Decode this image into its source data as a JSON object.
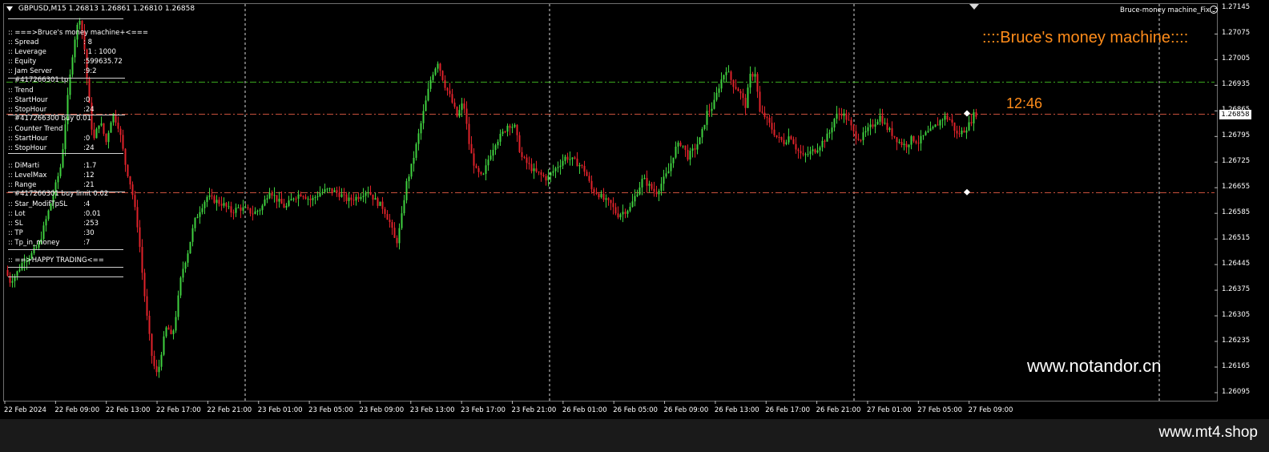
{
  "header": {
    "symbol": "GBPUSD,M15",
    "ohlc": "1.26813 1.26861 1.26810 1.26858",
    "ea_name": "Bruce-money machine_Fix"
  },
  "overlay": {
    "title": "::::Bruce's money machine::::",
    "timer": "12:46",
    "watermark": "www.notandor.cn",
    "site": "www.mt4.shop"
  },
  "info_panel": {
    "lines": [
      {
        "k": ":: ===>Bruce's money machine+<===",
        "v": ""
      },
      {
        "k": ":: Spread",
        "v": ": 8"
      },
      {
        "k": ":: Leverage",
        "v": ": 1 : 1000"
      },
      {
        "k": ":: Equity",
        "v": ":599635.72"
      },
      {
        "k": ":: Jam Server",
        "v": ":9:2"
      },
      {
        "k": "#417266301 tp",
        "v": ""
      },
      {
        "k": ":: Trend",
        "v": ""
      },
      {
        "k": ":: StartHour",
        "v": ":0"
      },
      {
        "k": ":: StopHour",
        "v": ":24"
      },
      {
        "k": "#417266300 buy 0.01",
        "v": ""
      },
      {
        "k": ":: Counter Trend",
        "v": ""
      },
      {
        "k": ":: StartHour",
        "v": ":0"
      },
      {
        "k": ":: StopHour",
        "v": ":24"
      },
      {
        "k": ":: DiMarti",
        "v": ":1.7"
      },
      {
        "k": ":: LevelMax",
        "v": ":12"
      },
      {
        "k": ":: Range",
        "v": ":21"
      },
      {
        "k": "#417266301 buy limit 0.02",
        "v": ""
      },
      {
        "k": ":: Star_ModifTpSL",
        "v": ":4"
      },
      {
        "k": ":: Lot",
        "v": ":0.01"
      },
      {
        "k": ":: SL",
        "v": ":253"
      },
      {
        "k": ":: TP",
        "v": ":30"
      },
      {
        "k": ":: Tp_in_money",
        "v": ":7"
      },
      {
        "k": ":: ==>HAPPY TRADING<==",
        "v": ""
      }
    ]
  },
  "chart_data": {
    "type": "candlestick",
    "symbol": "GBPUSD",
    "timeframe": "M15",
    "current_price": "1.26858",
    "ylim": [
      1.26073,
      1.27157
    ],
    "y_ticks": [
      "1.27145",
      "1.27075",
      "1.27005",
      "1.26935",
      "1.26865",
      "1.26795",
      "1.26725",
      "1.26655",
      "1.26585",
      "1.26515",
      "1.26445",
      "1.26375",
      "1.26305",
      "1.26235",
      "1.26165",
      "1.26095"
    ],
    "x_ticks": [
      "22 Feb 2024",
      "22 Feb 09:00",
      "22 Feb 13:00",
      "22 Feb 17:00",
      "22 Feb 21:00",
      "23 Feb 01:00",
      "23 Feb 05:00",
      "23 Feb 09:00",
      "23 Feb 13:00",
      "23 Feb 17:00",
      "23 Feb 21:00",
      "26 Feb 01:00",
      "26 Feb 05:00",
      "26 Feb 09:00",
      "26 Feb 13:00",
      "26 Feb 17:00",
      "26 Feb 21:00",
      "27 Feb 01:00",
      "27 Feb 05:00",
      "27 Feb 09:00"
    ],
    "period_separators": [
      "23 Feb 00:00",
      "26 Feb 00:00",
      "27 Feb 00:00",
      "28 Feb 00:00"
    ],
    "levels": [
      {
        "name": "take-profit",
        "price": 1.26944,
        "color": "#3aa81e",
        "style": "dash-dot"
      },
      {
        "name": "buy-order",
        "price": 1.26858,
        "color": "#c8503c",
        "style": "dash-dot"
      },
      {
        "name": "buy-limit",
        "price": 1.26643,
        "color": "#c8503c",
        "style": "dash-dot"
      }
    ],
    "bull_color": "#3fd13f",
    "bear_color": "#e0222a",
    "path": [
      [
        0,
        1.2643
      ],
      [
        6,
        1.264
      ],
      [
        14,
        1.2642
      ],
      [
        24,
        1.2646
      ],
      [
        32,
        1.2647
      ],
      [
        42,
        1.265
      ],
      [
        50,
        1.2656
      ],
      [
        58,
        1.2662
      ],
      [
        70,
        1.2672
      ],
      [
        78,
        1.269
      ],
      [
        84,
        1.2702
      ],
      [
        88,
        1.2708
      ],
      [
        93,
        1.2712
      ],
      [
        98,
        1.2706
      ],
      [
        104,
        1.269
      ],
      [
        110,
        1.2678
      ],
      [
        118,
        1.2684
      ],
      [
        126,
        1.2678
      ],
      [
        134,
        1.2686
      ],
      [
        142,
        1.2682
      ],
      [
        150,
        1.2672
      ],
      [
        158,
        1.2665
      ],
      [
        166,
        1.2654
      ],
      [
        172,
        1.264
      ],
      [
        178,
        1.2628
      ],
      [
        184,
        1.2618
      ],
      [
        190,
        1.2614
      ],
      [
        196,
        1.2622
      ],
      [
        202,
        1.2628
      ],
      [
        208,
        1.2624
      ],
      [
        214,
        1.2632
      ],
      [
        220,
        1.2642
      ],
      [
        228,
        1.2648
      ],
      [
        236,
        1.2656
      ],
      [
        244,
        1.266
      ],
      [
        252,
        1.2663
      ],
      [
        262,
        1.2662
      ],
      [
        272,
        1.2661
      ],
      [
        282,
        1.2659
      ],
      [
        292,
        1.266
      ],
      [
        300,
        1.26595
      ],
      [
        310,
        1.26585
      ],
      [
        320,
        1.266
      ],
      [
        330,
        1.2665
      ],
      [
        340,
        1.2662
      ],
      [
        350,
        1.266
      ],
      [
        360,
        1.2663
      ],
      [
        370,
        1.2664
      ],
      [
        382,
        1.2662
      ],
      [
        392,
        1.2664
      ],
      [
        404,
        1.2665
      ],
      [
        416,
        1.2664
      ],
      [
        428,
        1.2662
      ],
      [
        440,
        1.2663
      ],
      [
        452,
        1.2665
      ],
      [
        462,
        1.2662
      ],
      [
        472,
        1.266
      ],
      [
        480,
        1.2656
      ],
      [
        488,
        1.265
      ],
      [
        494,
        1.2656
      ],
      [
        500,
        1.2666
      ],
      [
        508,
        1.2672
      ],
      [
        516,
        1.268
      ],
      [
        524,
        1.2688
      ],
      [
        532,
        1.2696
      ],
      [
        540,
        1.27
      ],
      [
        548,
        1.2694
      ],
      [
        556,
        1.269
      ],
      [
        564,
        1.2685
      ],
      [
        572,
        1.2689
      ],
      [
        580,
        1.2676
      ],
      [
        588,
        1.267
      ],
      [
        596,
        1.2668
      ],
      [
        604,
        1.2674
      ],
      [
        612,
        1.2678
      ],
      [
        620,
        1.268
      ],
      [
        628,
        1.2683
      ],
      [
        636,
        1.2682
      ],
      [
        644,
        1.2674
      ],
      [
        652,
        1.2672
      ],
      [
        660,
        1.267
      ],
      [
        668,
        1.2669
      ],
      [
        676,
        1.2668
      ],
      [
        684,
        1.267
      ],
      [
        692,
        1.2672
      ],
      [
        700,
        1.2674
      ],
      [
        708,
        1.2673
      ],
      [
        716,
        1.2672
      ],
      [
        724,
        1.267
      ],
      [
        732,
        1.2665
      ],
      [
        740,
        1.2664
      ],
      [
        748,
        1.2662
      ],
      [
        756,
        1.2661
      ],
      [
        764,
        1.2658
      ],
      [
        772,
        1.2659
      ],
      [
        780,
        1.266
      ],
      [
        788,
        1.2664
      ],
      [
        796,
        1.2668
      ],
      [
        804,
        1.2666
      ],
      [
        812,
        1.2664
      ],
      [
        820,
        1.2667
      ],
      [
        828,
        1.267
      ],
      [
        836,
        1.2676
      ],
      [
        844,
        1.2678
      ],
      [
        852,
        1.2674
      ],
      [
        860,
        1.2676
      ],
      [
        868,
        1.2679
      ],
      [
        876,
        1.2686
      ],
      [
        884,
        1.2688
      ],
      [
        892,
        1.2694
      ],
      [
        900,
        1.2698
      ],
      [
        908,
        1.2694
      ],
      [
        916,
        1.2692
      ],
      [
        924,
        1.2688
      ],
      [
        930,
        1.2696
      ],
      [
        936,
        1.2697
      ],
      [
        942,
        1.2686
      ],
      [
        948,
        1.2685
      ],
      [
        956,
        1.2682
      ],
      [
        964,
        1.2679
      ],
      [
        972,
        1.2678
      ],
      [
        980,
        1.268
      ],
      [
        988,
        1.2676
      ],
      [
        996,
        1.2674
      ],
      [
        1004,
        1.2675
      ],
      [
        1012,
        1.2676
      ],
      [
        1020,
        1.2678
      ],
      [
        1028,
        1.268
      ],
      [
        1036,
        1.2685
      ],
      [
        1044,
        1.2686
      ],
      [
        1052,
        1.2684
      ],
      [
        1060,
        1.268
      ],
      [
        1068,
        1.2679
      ],
      [
        1076,
        1.2681
      ],
      [
        1084,
        1.2683
      ],
      [
        1092,
        1.2685
      ],
      [
        1100,
        1.2682
      ],
      [
        1108,
        1.268
      ],
      [
        1116,
        1.2678
      ],
      [
        1124,
        1.2677
      ],
      [
        1132,
        1.2679
      ],
      [
        1140,
        1.2678
      ],
      [
        1148,
        1.268
      ],
      [
        1156,
        1.2681
      ],
      [
        1164,
        1.2683
      ],
      [
        1172,
        1.2685
      ],
      [
        1180,
        1.2684
      ],
      [
        1188,
        1.268
      ],
      [
        1196,
        1.2681
      ],
      [
        1204,
        1.2683
      ],
      [
        1210,
        1.26858
      ]
    ]
  }
}
